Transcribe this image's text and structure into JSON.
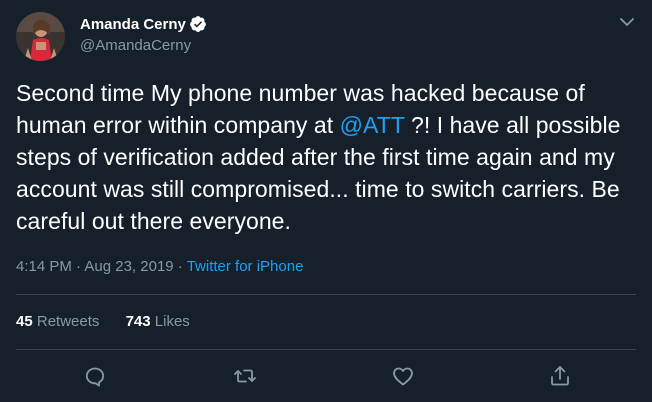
{
  "author": {
    "display_name": "Amanda Cerny",
    "handle": "@AmandaCerny"
  },
  "tweet": {
    "text_before": "Second time My phone number was hacked because of human error within company at ",
    "mention": "@ATT",
    "text_after": " ?! I have all possible steps of verification added after the first time again and my account was still compromised... time to switch carriers. Be careful out there everyone.",
    "time": "4:14 PM",
    "separator": " · ",
    "date": "Aug 23, 2019",
    "separator2": " · ",
    "source": "Twitter for iPhone"
  },
  "stats": {
    "retweets_count": "45",
    "retweets_label": "Retweets",
    "likes_count": "743",
    "likes_label": "Likes"
  },
  "icons": {
    "verified": "verified-badge-icon",
    "caret": "chevron-down-icon",
    "reply": "reply-icon",
    "retweet": "retweet-icon",
    "like": "heart-icon",
    "share": "share-icon"
  },
  "colors": {
    "background": "#15202b",
    "accent": "#1da1f2",
    "secondary_text": "#8899a6",
    "divider": "#38444d"
  }
}
